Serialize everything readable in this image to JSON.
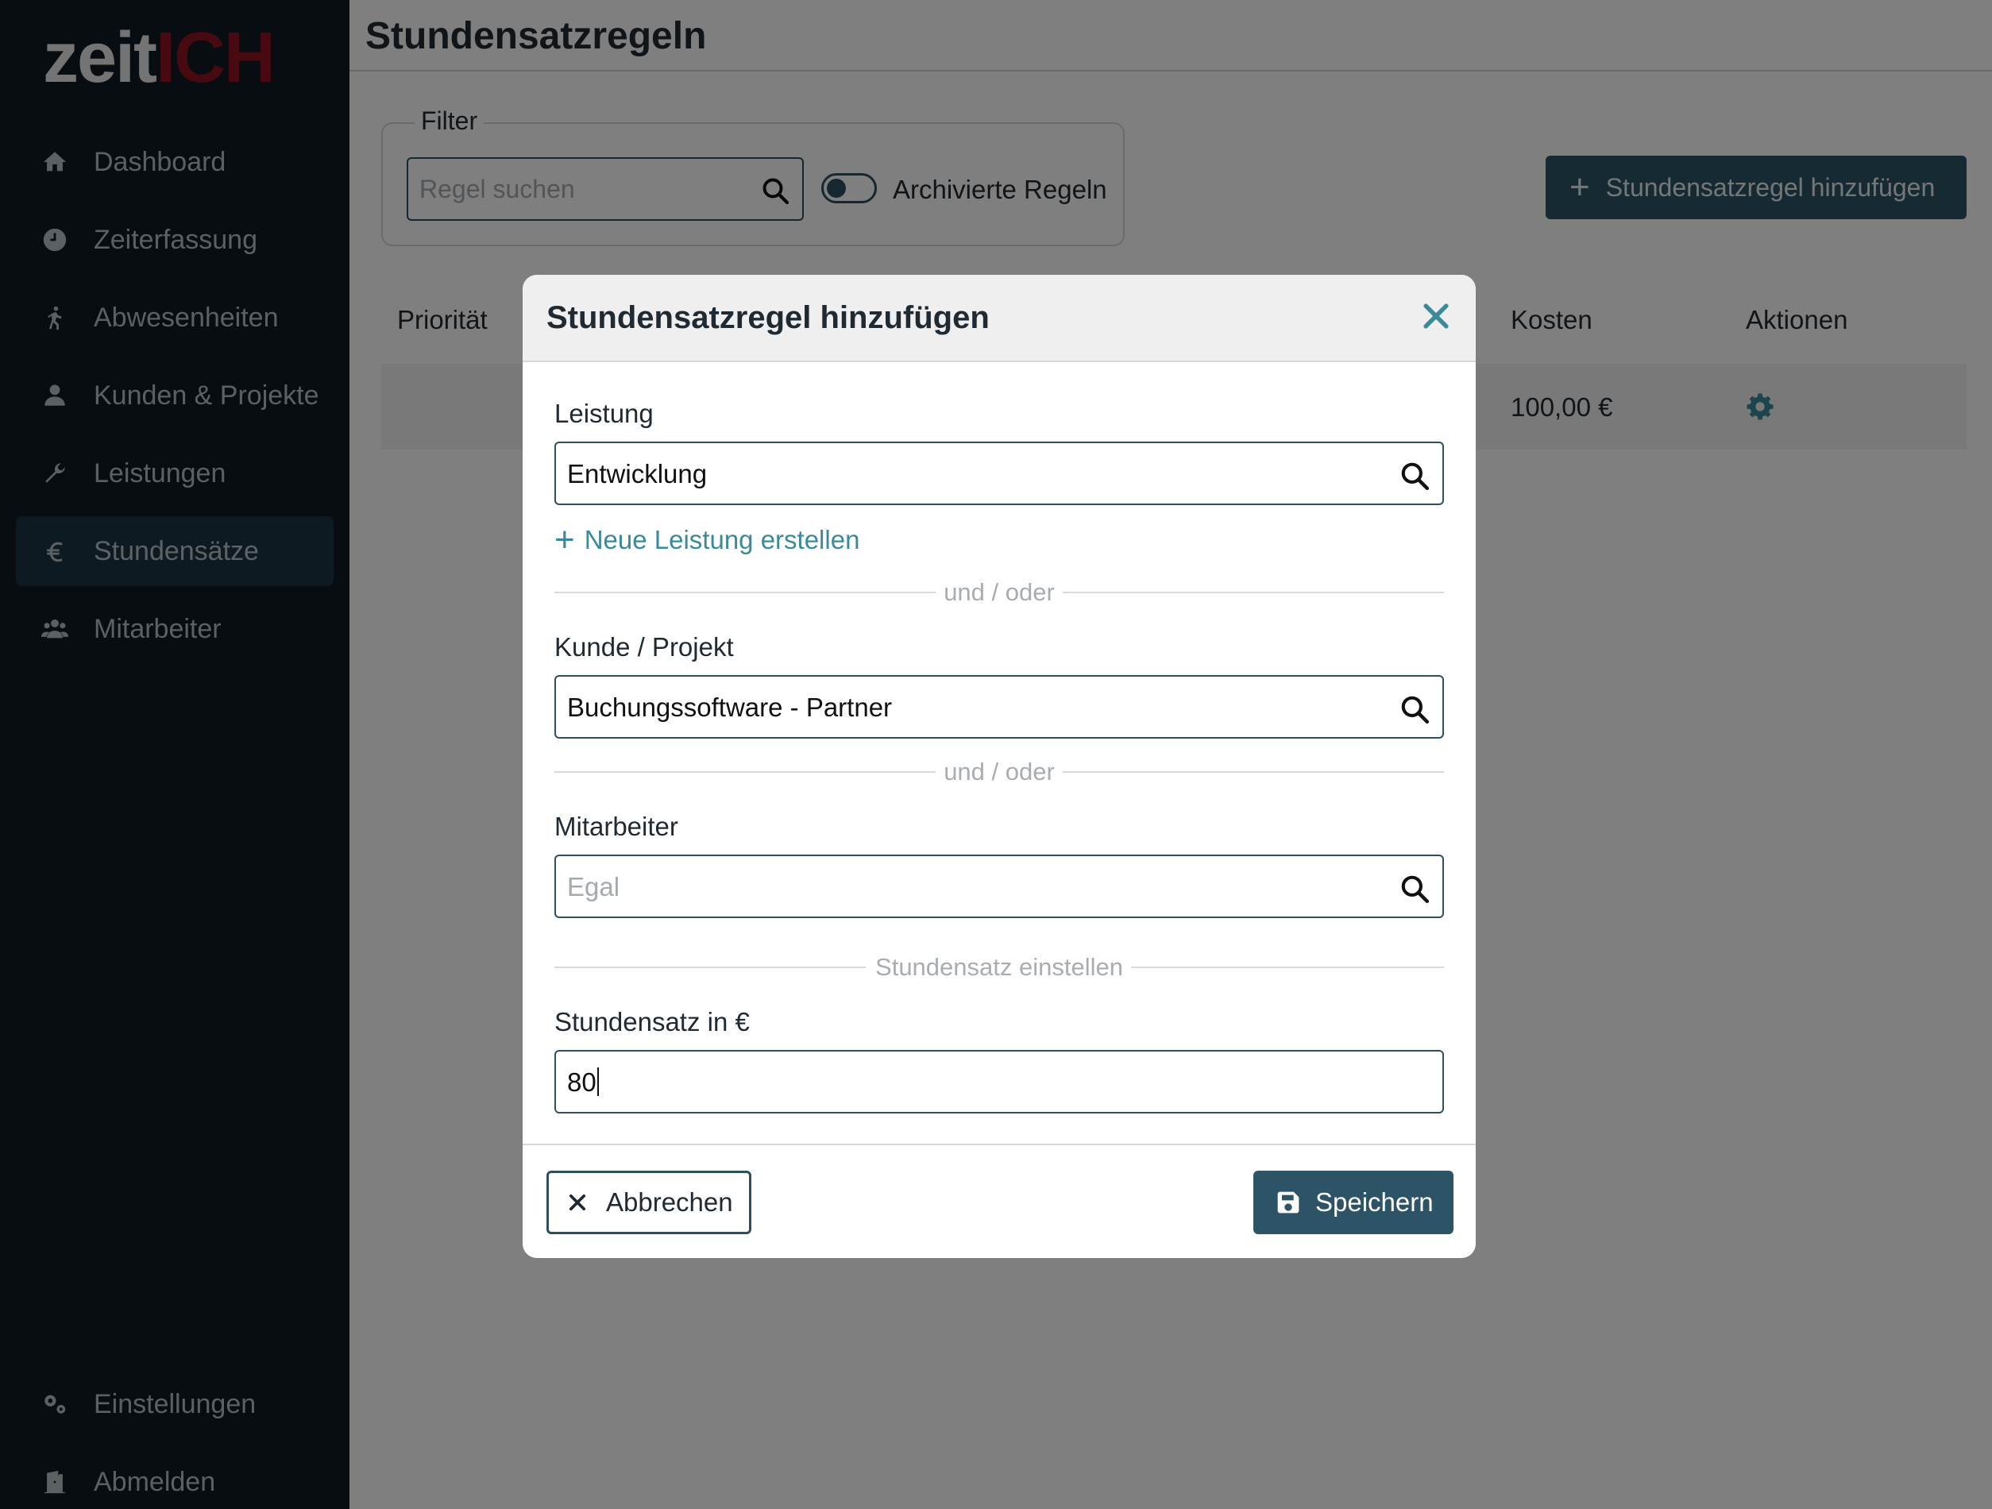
{
  "sidebar": {
    "logo_part1": "zeit",
    "logo_part2": "ICH",
    "items": [
      {
        "label": "Dashboard",
        "icon": "home-icon"
      },
      {
        "label": "Zeiterfassung",
        "icon": "clock-icon"
      },
      {
        "label": "Abwesenheiten",
        "icon": "walking-icon"
      },
      {
        "label": "Kunden & Projekte",
        "icon": "user-icon"
      },
      {
        "label": "Leistungen",
        "icon": "wrench-icon"
      },
      {
        "label": "Stundensätze",
        "icon": "euro-icon",
        "active": true
      },
      {
        "label": "Mitarbeiter",
        "icon": "users-icon"
      }
    ],
    "bottom": [
      {
        "label": "Einstellungen",
        "icon": "gears-icon"
      },
      {
        "label": "Abmelden",
        "icon": "door-icon"
      }
    ]
  },
  "page": {
    "title": "Stundensatzregeln",
    "filter": {
      "legend": "Filter",
      "search_placeholder": "Regel suchen",
      "toggle_label": "Archivierte Regeln",
      "toggle_on": false
    },
    "add_button": "Stundensatzregel hinzufügen",
    "table": {
      "headers": [
        "Priorität",
        "Kosten",
        "Aktionen"
      ],
      "rows": [
        {
          "kosten": "100,00 €"
        }
      ]
    }
  },
  "modal": {
    "title": "Stundensatzregel hinzufügen",
    "leistung": {
      "label": "Leistung",
      "value": "Entwicklung"
    },
    "new_service_link": "Neue Leistung erstellen",
    "divider_1": "und / oder",
    "kunde": {
      "label": "Kunde / Projekt",
      "value": "Buchungssoftware - Partner"
    },
    "divider_2": "und / oder",
    "mitarbeiter": {
      "label": "Mitarbeiter",
      "placeholder": "Egal"
    },
    "divider_3": "Stundensatz einstellen",
    "rate": {
      "label": "Stundensatz in €",
      "value": "80"
    },
    "cancel_label": "Abbrechen",
    "save_label": "Speichern"
  },
  "colors": {
    "sidebar_bg": "#0e1b23",
    "accent": "#2c5466",
    "logo_red": "#8e1420",
    "link": "#3a8a9a"
  }
}
